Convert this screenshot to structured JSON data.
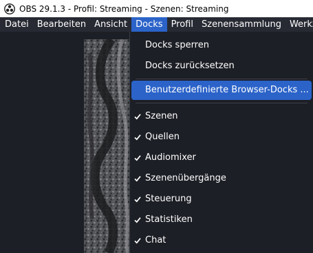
{
  "window": {
    "title": "OBS 29.1.3 - Profil: Streaming - Szenen: Streaming",
    "app_icon": "obs-logo-icon"
  },
  "menubar": {
    "items": [
      {
        "label": "Datei"
      },
      {
        "label": "Bearbeiten"
      },
      {
        "label": "Ansicht"
      },
      {
        "label": "Docks"
      },
      {
        "label": "Profil"
      },
      {
        "label": "Szenensammlung"
      },
      {
        "label": "Werkz"
      }
    ],
    "active_index": 3
  },
  "docks_menu": {
    "actions": [
      {
        "label": "Docks sperren"
      },
      {
        "label": "Docks zurücksetzen"
      }
    ],
    "custom": {
      "label": "Benutzerdefinierte Browser-Docks ..."
    },
    "checkables": [
      {
        "label": "Szenen",
        "checked": true
      },
      {
        "label": "Quellen",
        "checked": true
      },
      {
        "label": "Audiomixer",
        "checked": true
      },
      {
        "label": "Szenenübergänge",
        "checked": true
      },
      {
        "label": "Steuerung",
        "checked": true
      },
      {
        "label": "Statistiken",
        "checked": true
      },
      {
        "label": "Chat",
        "checked": true
      }
    ],
    "check_icon": "checkmark-icon"
  },
  "colors": {
    "titlebar_bg": "#ffffff",
    "menubar_bg": "#272a33",
    "window_bg": "#1d1f26",
    "accent": "#2b63c9",
    "text": "#ffffff"
  }
}
